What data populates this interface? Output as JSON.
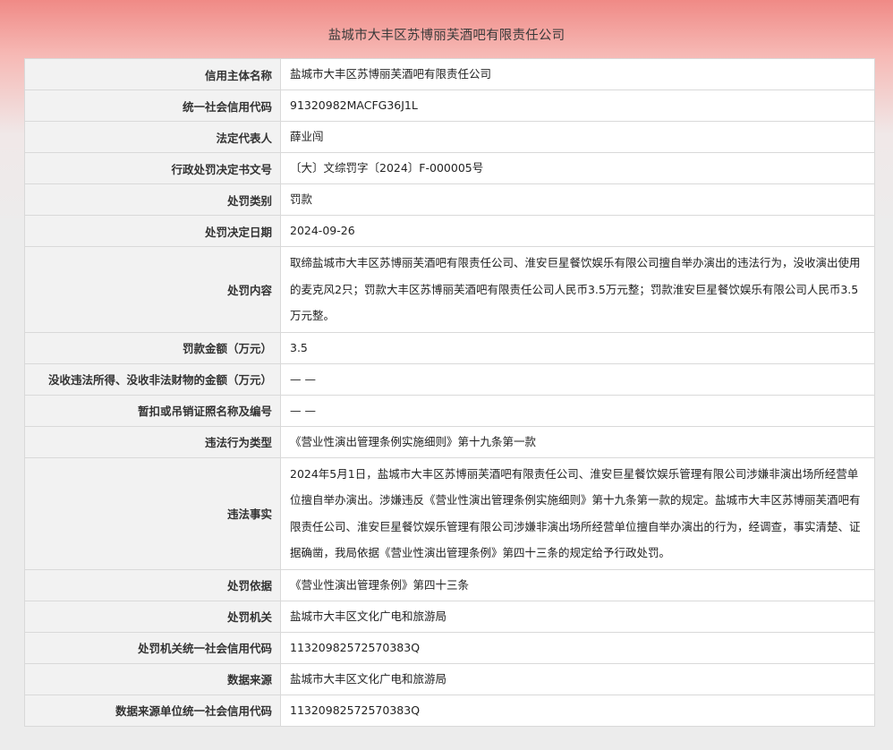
{
  "title": "盐城市大丰区苏博丽芙酒吧有限责任公司",
  "rows": [
    {
      "label": "信用主体名称",
      "value": "盐城市大丰区苏博丽芙酒吧有限责任公司"
    },
    {
      "label": "统一社会信用代码",
      "value": "91320982MACFG36J1L"
    },
    {
      "label": "法定代表人",
      "value": "薛业闯"
    },
    {
      "label": "行政处罚决定书文号",
      "value": "〔大〕文综罚字〔2024〕F-000005号"
    },
    {
      "label": "处罚类别",
      "value": "罚款"
    },
    {
      "label": "处罚决定日期",
      "value": "2024-09-26"
    },
    {
      "label": "处罚内容",
      "value": "取缔盐城市大丰区苏博丽芙酒吧有限责任公司、淮安巨星餐饮娱乐有限公司擅自举办演出的违法行为，没收演出使用的麦克风2只；罚款大丰区苏博丽芙酒吧有限责任公司人民币3.5万元整；罚款淮安巨星餐饮娱乐有限公司人民币3.5万元整。"
    },
    {
      "label": "罚款金额（万元）",
      "value": "3.5"
    },
    {
      "label": "没收违法所得、没收非法财物的金额（万元）",
      "value": "— —"
    },
    {
      "label": "暂扣或吊销证照名称及编号",
      "value": "— —"
    },
    {
      "label": "违法行为类型",
      "value": "《营业性演出管理条例实施细则》第十九条第一款"
    },
    {
      "label": "违法事实",
      "value": "2024年5月1日，盐城市大丰区苏博丽芙酒吧有限责任公司、淮安巨星餐饮娱乐管理有限公司涉嫌非演出场所经营单位擅自举办演出。涉嫌违反《营业性演出管理条例实施细则》第十九条第一款的规定。盐城市大丰区苏博丽芙酒吧有限责任公司、淮安巨星餐饮娱乐管理有限公司涉嫌非演出场所经营单位擅自举办演出的行为，经调查，事实清楚、证据确凿，我局依据《营业性演出管理条例》第四十三条的规定给予行政处罚。"
    },
    {
      "label": "处罚依据",
      "value": "《营业性演出管理条例》第四十三条"
    },
    {
      "label": "处罚机关",
      "value": "盐城市大丰区文化广电和旅游局"
    },
    {
      "label": "处罚机关统一社会信用代码",
      "value": "11320982572570383Q"
    },
    {
      "label": "数据来源",
      "value": "盐城市大丰区文化广电和旅游局"
    },
    {
      "label": "数据来源单位统一社会信用代码",
      "value": "11320982572570383Q"
    }
  ]
}
